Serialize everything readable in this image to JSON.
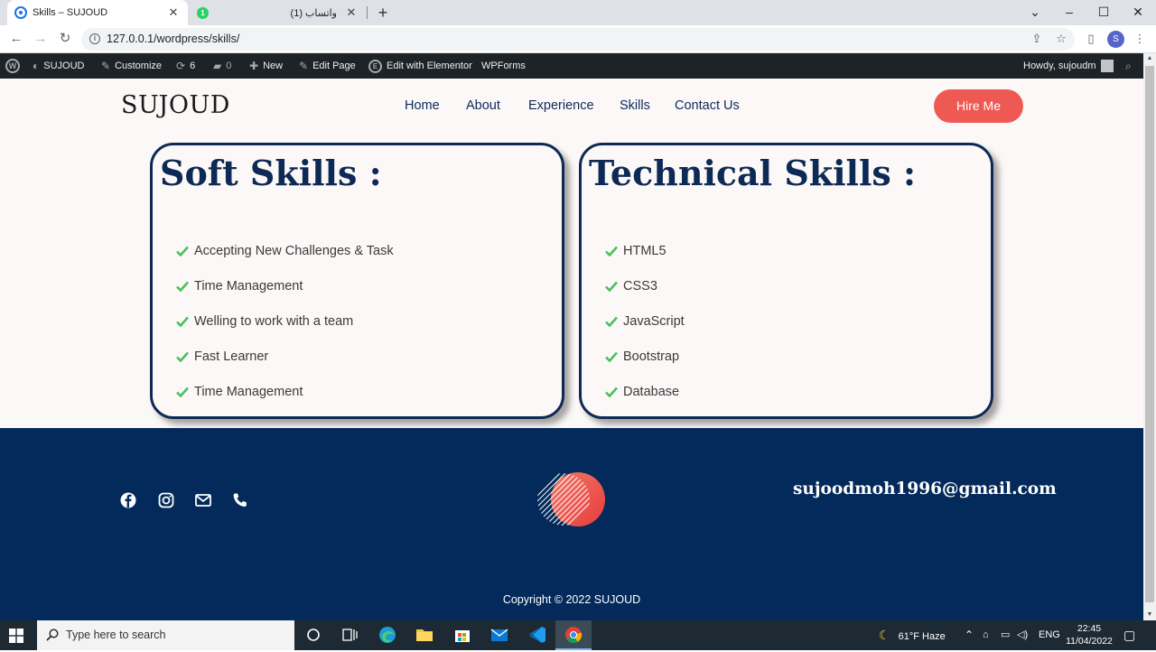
{
  "browser": {
    "tabs": [
      {
        "title": "Skills – SUJOUD",
        "active": true
      },
      {
        "title": "(1) واتساب",
        "active": false
      }
    ],
    "url": "127.0.0.1/wordpress/skills/",
    "profile_initial": "S"
  },
  "admin_bar": {
    "site": "SUJOUD",
    "customize": "Customize",
    "updates": "6",
    "comments": "0",
    "new": "New",
    "edit_page": "Edit Page",
    "edit_elementor": "Edit with Elementor",
    "wpforms": "WPForms",
    "howdy": "Howdy, sujoudm"
  },
  "header": {
    "logo": "SUJOUD",
    "nav": [
      "Home",
      "About",
      "Experience",
      "Skills",
      "Contact Us"
    ],
    "cta": "Hire Me"
  },
  "soft_skills": {
    "title": "Soft Skills :",
    "items": [
      "Accepting New Challenges & Task",
      "Time Management",
      "Welling to work with a team",
      "Fast Learner",
      "Time Management"
    ]
  },
  "technical_skills": {
    "title": "Technical Skills :",
    "items": [
      "HTML5",
      "CSS3",
      "JavaScript",
      "Bootstrap",
      "Database"
    ]
  },
  "footer": {
    "email": "sujoodmoh1996@gmail.com",
    "copyright": "Copyright © 2022 SUJOUD",
    "social_icons": [
      "facebook-icon",
      "instagram-icon",
      "mail-icon",
      "phone-icon"
    ]
  },
  "taskbar": {
    "search_placeholder": "Type here to search",
    "weather": "61°F  Haze",
    "lang": "ENG",
    "time": "22:45",
    "date": "11/04/2022"
  },
  "colors": {
    "navy": "#0c2a55",
    "accent": "#ee5a53",
    "check": "#4cc05a",
    "footer_bg": "#032a5a"
  }
}
